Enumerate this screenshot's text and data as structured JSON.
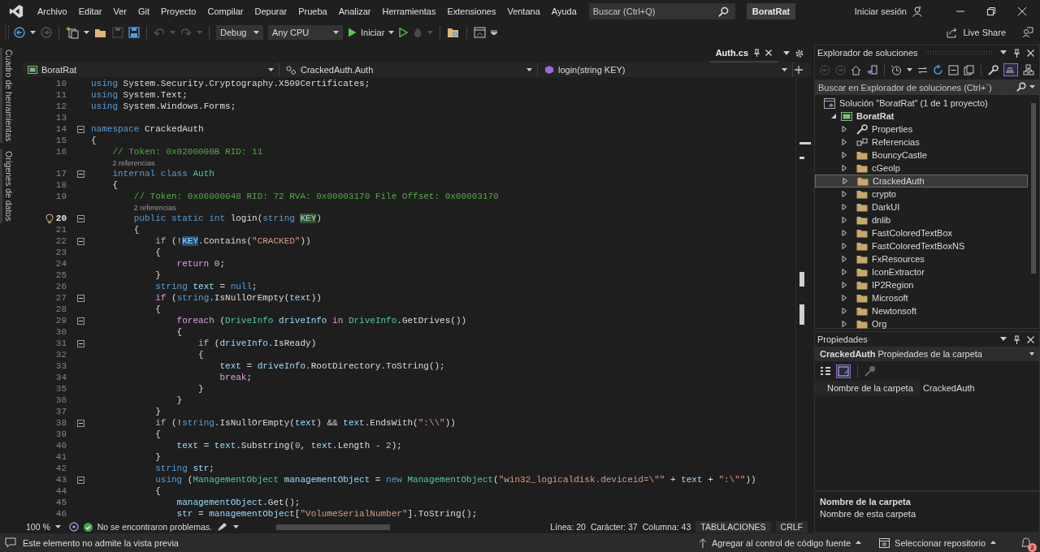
{
  "menu": [
    "Archivo",
    "Editar",
    "Ver",
    "Git",
    "Proyecto",
    "Compilar",
    "Depurar",
    "Prueba",
    "Analizar",
    "Herramientas",
    "Extensiones",
    "Ventana",
    "Ayuda"
  ],
  "search": {
    "placeholder": "Buscar (Ctrl+Q)"
  },
  "solution_badge": "BoratRat",
  "sign_in": "Iniciar sesión",
  "toolbar": {
    "configuration": "Debug",
    "platform": "Any CPU",
    "start": "Iniciar",
    "live_share": "Live Share"
  },
  "side_tabs": [
    "Cuadro de herramientas",
    "Orígenes de datos"
  ],
  "editor": {
    "tab": {
      "label": "Auth.cs",
      "selected": true
    },
    "nav": [
      "BoratRat",
      "CrackedAuth.Auth",
      "login(string KEY)"
    ],
    "lines": [
      {
        "kind": "code",
        "n": "10",
        "fold": false,
        "current": false,
        "code": [
          {
            "text": "using",
            "kind": "keyword"
          },
          {
            "text": " System.Security.Cryptography.X509Certificates;",
            "kind": "plain"
          }
        ]
      },
      {
        "kind": "code",
        "n": "11",
        "fold": false,
        "current": false,
        "code": [
          {
            "text": "using",
            "kind": "keyword"
          },
          {
            "text": " System.Text;",
            "kind": "plain"
          }
        ]
      },
      {
        "kind": "code",
        "n": "12",
        "fold": false,
        "current": false,
        "code": [
          {
            "text": "using",
            "kind": "keyword"
          },
          {
            "text": " System.Windows.Forms;",
            "kind": "plain"
          }
        ]
      },
      {
        "kind": "code",
        "n": "13",
        "fold": false,
        "current": false
      },
      {
        "kind": "code",
        "n": "14",
        "fold": true,
        "current": false,
        "code": [
          {
            "text": "namespace",
            "kind": "keyword"
          },
          {
            "text": " CrackedAuth",
            "kind": "plain"
          }
        ]
      },
      {
        "kind": "code",
        "n": "15",
        "fold": false,
        "current": false,
        "code": [
          {
            "text": "{",
            "kind": "plain"
          }
        ]
      },
      {
        "kind": "code",
        "n": "16",
        "fold": false,
        "current": false,
        "code": [
          {
            "text": "    // Token: 0x0200000B RID: 11",
            "kind": "comment"
          }
        ]
      },
      {
        "kind": "codelens",
        "text": "    2 referencias"
      },
      {
        "kind": "code",
        "n": "17",
        "fold": true,
        "current": false,
        "code": [
          {
            "text": "    internal",
            "kind": "keyword"
          },
          {
            "text": " class",
            "kind": "keyword"
          },
          {
            "text": " Auth",
            "kind": "type"
          }
        ]
      },
      {
        "kind": "code",
        "n": "18",
        "fold": false,
        "current": false,
        "code": [
          {
            "text": "    {",
            "kind": "plain"
          }
        ]
      },
      {
        "kind": "code",
        "n": "19",
        "fold": false,
        "current": false,
        "code": [
          {
            "text": "        // Token: 0x06000048 RID: 72 RVA: 0x00003170 File Offset: 0x00003170",
            "kind": "comment"
          }
        ]
      },
      {
        "kind": "codelens",
        "text": "        2 referencias"
      },
      {
        "kind": "code",
        "n": "20",
        "fold": true,
        "current": true,
        "code": [
          {
            "text": "        public",
            "kind": "keyword"
          },
          {
            "text": " static",
            "kind": "keyword"
          },
          {
            "text": " int",
            "kind": "keyword"
          },
          {
            "text": " login(",
            "kind": "plain"
          },
          {
            "text": "string ",
            "kind": "keyword"
          },
          {
            "text": "KEY",
            "kind": "definition"
          },
          {
            "text": ")",
            "kind": "plain"
          }
        ]
      },
      {
        "kind": "code",
        "n": "21",
        "fold": false,
        "current": false,
        "code": [
          {
            "text": "        {",
            "kind": "plain"
          }
        ]
      },
      {
        "kind": "code",
        "n": "22",
        "fold": true,
        "current": false,
        "code": [
          {
            "text": "            if",
            "kind": "control"
          },
          {
            "text": " (!",
            "kind": "plain"
          },
          {
            "text": "KEY",
            "kind": "reference"
          },
          {
            "text": ".Contains(",
            "kind": "plain"
          },
          {
            "text": "\"CRACKED\"",
            "kind": "string"
          },
          {
            "text": "))",
            "kind": "plain"
          }
        ]
      },
      {
        "kind": "code",
        "n": "23",
        "fold": false,
        "current": false,
        "code": [
          {
            "text": "            {",
            "kind": "plain"
          }
        ]
      },
      {
        "kind": "code",
        "n": "24",
        "fold": false,
        "current": false,
        "code": [
          {
            "text": "                return",
            "kind": "control"
          },
          {
            "text": " 0",
            "kind": "number"
          },
          {
            "text": ";",
            "kind": "plain"
          }
        ]
      },
      {
        "kind": "code",
        "n": "25",
        "fold": false,
        "current": false,
        "code": [
          {
            "text": "            }",
            "kind": "plain"
          }
        ]
      },
      {
        "kind": "code",
        "n": "26",
        "fold": false,
        "current": false,
        "code": [
          {
            "text": "            string",
            "kind": "keyword"
          },
          {
            "text": " text",
            "kind": "variable"
          },
          {
            "text": " = ",
            "kind": "plain"
          },
          {
            "text": "null",
            "kind": "keyword"
          },
          {
            "text": ";",
            "kind": "plain"
          }
        ]
      },
      {
        "kind": "code",
        "n": "27",
        "fold": true,
        "current": false,
        "code": [
          {
            "text": "            if",
            "kind": "control"
          },
          {
            "text": " (",
            "kind": "plain"
          },
          {
            "text": "string",
            "kind": "keyword"
          },
          {
            "text": ".IsNullOrEmpty(",
            "kind": "plain"
          },
          {
            "text": "text",
            "kind": "variable"
          },
          {
            "text": "))",
            "kind": "plain"
          }
        ]
      },
      {
        "kind": "code",
        "n": "28",
        "fold": false,
        "current": false,
        "code": [
          {
            "text": "            {",
            "kind": "plain"
          }
        ]
      },
      {
        "kind": "code",
        "n": "29",
        "fold": true,
        "current": false,
        "code": [
          {
            "text": "                foreach",
            "kind": "control"
          },
          {
            "text": " (",
            "kind": "plain"
          },
          {
            "text": "DriveInfo",
            "kind": "type"
          },
          {
            "text": " driveInfo",
            "kind": "variable"
          },
          {
            "text": " in",
            "kind": "control"
          },
          {
            "text": " DriveInfo",
            "kind": "type"
          },
          {
            "text": ".GetDrives())",
            "kind": "plain"
          }
        ]
      },
      {
        "kind": "code",
        "n": "30",
        "fold": false,
        "current": false,
        "code": [
          {
            "text": "                {",
            "kind": "plain"
          }
        ]
      },
      {
        "kind": "code",
        "n": "31",
        "fold": true,
        "current": false,
        "code": [
          {
            "text": "                    if",
            "kind": "control"
          },
          {
            "text": " (",
            "kind": "plain"
          },
          {
            "text": "driveInfo",
            "kind": "variable"
          },
          {
            "text": ".IsReady)",
            "kind": "plain"
          }
        ]
      },
      {
        "kind": "code",
        "n": "32",
        "fold": false,
        "current": false,
        "code": [
          {
            "text": "                    {",
            "kind": "plain"
          }
        ]
      },
      {
        "kind": "code",
        "n": "33",
        "fold": false,
        "current": false,
        "code": [
          {
            "text": "                        text",
            "kind": "variable"
          },
          {
            "text": " = ",
            "kind": "plain"
          },
          {
            "text": "driveInfo",
            "kind": "variable"
          },
          {
            "text": ".RootDirectory.ToString();",
            "kind": "plain"
          }
        ]
      },
      {
        "kind": "code",
        "n": "34",
        "fold": false,
        "current": false,
        "code": [
          {
            "text": "                        break",
            "kind": "control"
          },
          {
            "text": ";",
            "kind": "plain"
          }
        ]
      },
      {
        "kind": "code",
        "n": "35",
        "fold": false,
        "current": false,
        "code": [
          {
            "text": "                    }",
            "kind": "plain"
          }
        ]
      },
      {
        "kind": "code",
        "n": "36",
        "fold": false,
        "current": false,
        "code": [
          {
            "text": "                }",
            "kind": "plain"
          }
        ]
      },
      {
        "kind": "code",
        "n": "37",
        "fold": false,
        "current": false,
        "code": [
          {
            "text": "            }",
            "kind": "plain"
          }
        ]
      },
      {
        "kind": "code",
        "n": "38",
        "fold": true,
        "current": false,
        "code": [
          {
            "text": "            if",
            "kind": "control"
          },
          {
            "text": " (!",
            "kind": "plain"
          },
          {
            "text": "string",
            "kind": "keyword"
          },
          {
            "text": ".IsNullOrEmpty(",
            "kind": "plain"
          },
          {
            "text": "text",
            "kind": "variable"
          },
          {
            "text": ") && ",
            "kind": "plain"
          },
          {
            "text": "text",
            "kind": "variable"
          },
          {
            "text": ".EndsWith(",
            "kind": "plain"
          },
          {
            "text": "\":\\\\\"",
            "kind": "string"
          },
          {
            "text": "))",
            "kind": "plain"
          }
        ]
      },
      {
        "kind": "code",
        "n": "39",
        "fold": false,
        "current": false,
        "code": [
          {
            "text": "            {",
            "kind": "plain"
          }
        ]
      },
      {
        "kind": "code",
        "n": "40",
        "fold": false,
        "current": false,
        "code": [
          {
            "text": "                text",
            "kind": "variable"
          },
          {
            "text": " = ",
            "kind": "plain"
          },
          {
            "text": "text",
            "kind": "variable"
          },
          {
            "text": ".Substring(",
            "kind": "plain"
          },
          {
            "text": "0",
            "kind": "number"
          },
          {
            "text": ", ",
            "kind": "plain"
          },
          {
            "text": "text",
            "kind": "variable"
          },
          {
            "text": ".Length - ",
            "kind": "plain"
          },
          {
            "text": "2",
            "kind": "number"
          },
          {
            "text": ");",
            "kind": "plain"
          }
        ]
      },
      {
        "kind": "code",
        "n": "41",
        "fold": false,
        "current": false,
        "code": [
          {
            "text": "            }",
            "kind": "plain"
          }
        ]
      },
      {
        "kind": "code",
        "n": "42",
        "fold": false,
        "current": false,
        "code": [
          {
            "text": "            string",
            "kind": "keyword"
          },
          {
            "text": " str",
            "kind": "variable"
          },
          {
            "text": ";",
            "kind": "plain"
          }
        ]
      },
      {
        "kind": "code",
        "n": "43",
        "fold": true,
        "current": false,
        "code": [
          {
            "text": "            using",
            "kind": "keyword"
          },
          {
            "text": " (",
            "kind": "plain"
          },
          {
            "text": "ManagementObject",
            "kind": "type"
          },
          {
            "text": " managementObject",
            "kind": "variable"
          },
          {
            "text": " = ",
            "kind": "plain"
          },
          {
            "text": "new",
            "kind": "keyword"
          },
          {
            "text": " ManagementObject",
            "kind": "type"
          },
          {
            "text": "(",
            "kind": "plain"
          },
          {
            "text": "\"win32_logicaldisk.deviceid=\\\"\"",
            "kind": "string"
          },
          {
            "text": " + ",
            "kind": "plain"
          },
          {
            "text": "text",
            "kind": "variable"
          },
          {
            "text": " + ",
            "kind": "plain"
          },
          {
            "text": "\":\\\"\"",
            "kind": "string"
          },
          {
            "text": "))",
            "kind": "plain"
          }
        ]
      },
      {
        "kind": "code",
        "n": "44",
        "fold": false,
        "current": false,
        "code": [
          {
            "text": "            {",
            "kind": "plain"
          }
        ]
      },
      {
        "kind": "code",
        "n": "45",
        "fold": false,
        "current": false,
        "code": [
          {
            "text": "                managementObject",
            "kind": "variable"
          },
          {
            "text": ".Get();",
            "kind": "plain"
          }
        ]
      },
      {
        "kind": "code",
        "n": "46",
        "fold": false,
        "current": false,
        "code": [
          {
            "text": "                str",
            "kind": "variable"
          },
          {
            "text": " = ",
            "kind": "plain"
          },
          {
            "text": "managementObject",
            "kind": "variable"
          },
          {
            "text": "[",
            "kind": "plain"
          },
          {
            "text": "\"VolumeSerialNumber\"",
            "kind": "string"
          },
          {
            "text": "].ToString();",
            "kind": "plain"
          }
        ]
      }
    ],
    "status": {
      "zoom": "100 %",
      "problems": "No se encontraron problemas.",
      "line": "Línea: 20",
      "char": "Carácter: 37",
      "col": "Columna: 43",
      "indent": "TABULACIONES",
      "eol": "CRLF"
    }
  },
  "solution_explorer": {
    "title": "Explorador de soluciones",
    "search": {
      "placeholder": "Buscar en Explorador de soluciones (Ctrl+`)"
    },
    "solution": "Solución \"BoratRat\"  (1 de 1 proyecto)",
    "project": {
      "label": "BoratRat",
      "expanded": true,
      "children": [
        {
          "label": "Properties",
          "kind": "properties",
          "selected": false,
          "expanded": false
        },
        {
          "label": "Referencias",
          "kind": "references",
          "selected": false,
          "expanded": false
        },
        {
          "label": "BouncyCastle",
          "kind": "folder",
          "selected": false,
          "expanded": false
        },
        {
          "label": "cGeolp",
          "kind": "folder",
          "selected": false,
          "expanded": false
        },
        {
          "label": "CrackedAuth",
          "kind": "folder",
          "selected": true,
          "expanded": false
        },
        {
          "label": "crypto",
          "kind": "folder",
          "selected": false,
          "expanded": false
        },
        {
          "label": "DarkUI",
          "kind": "folder",
          "selected": false,
          "expanded": false
        },
        {
          "label": "dnlib",
          "kind": "folder",
          "selected": false,
          "expanded": false
        },
        {
          "label": "FastColoredTextBox",
          "kind": "folder",
          "selected": false,
          "expanded": false
        },
        {
          "label": "FastColoredTextBoxNS",
          "kind": "folder",
          "selected": false,
          "expanded": false
        },
        {
          "label": "FxResources",
          "kind": "folder",
          "selected": false,
          "expanded": false
        },
        {
          "label": "IconExtractor",
          "kind": "folder",
          "selected": false,
          "expanded": false
        },
        {
          "label": "IP2Region",
          "kind": "folder",
          "selected": false,
          "expanded": false
        },
        {
          "label": "Microsoft",
          "kind": "folder",
          "selected": false,
          "expanded": false
        },
        {
          "label": "Newtonsoft",
          "kind": "folder",
          "selected": false,
          "expanded": false
        },
        {
          "label": "Org",
          "kind": "folder",
          "selected": false,
          "expanded": false
        }
      ]
    }
  },
  "properties": {
    "title": "Propiedades",
    "object": "CrackedAuth",
    "object_type": "Propiedades de la carpeta",
    "rows": [
      {
        "name": "Nombre de la carpeta",
        "value": "CrackedAuth"
      }
    ],
    "description_title": "Nombre de la carpeta",
    "description": "Nombre de esta carpeta"
  },
  "status_bar": {
    "message": "Este elemento no admite la vista previa",
    "source_control": "Agregar al control de código fuente",
    "repository": "Seleccionar repositorio",
    "notifications": "2"
  }
}
